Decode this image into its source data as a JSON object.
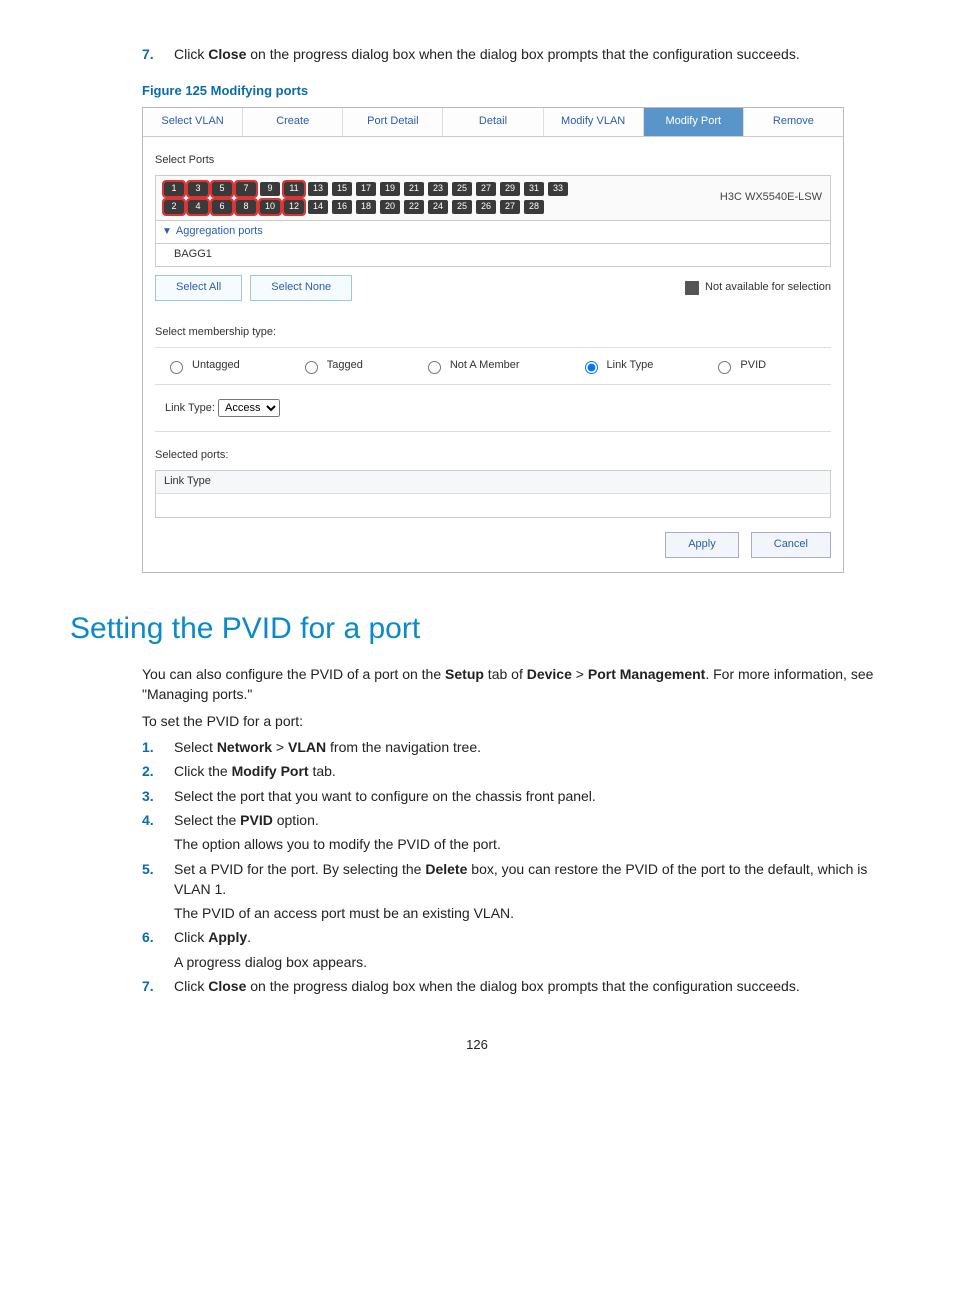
{
  "topStep": {
    "num": "7.",
    "text_a": "Click ",
    "bold": "Close",
    "text_b": " on the progress dialog box when the dialog box prompts that the configuration succeeds."
  },
  "figCaption": "Figure 125 Modifying ports",
  "tabs": [
    "Select VLAN",
    "Create",
    "Port Detail",
    "Detail",
    "Modify VLAN",
    "Modify Port",
    "Remove"
  ],
  "activeTab": 5,
  "selectPortsLabel": "Select Ports",
  "portsTop": [
    "1",
    "3",
    "5",
    "7",
    "9",
    "11",
    "13",
    "15",
    "17",
    "19",
    "21",
    "23",
    "25",
    "27",
    "29",
    "31",
    "33"
  ],
  "portsBottom": [
    "2",
    "4",
    "6",
    "8",
    "10",
    "12",
    "14",
    "16",
    "18",
    "20",
    "22",
    "24",
    "25",
    "26",
    "27",
    "28"
  ],
  "model": "H3C WX5540E-LSW",
  "aggHeader": "Aggregation ports",
  "aggItem": "BAGG1",
  "selectAll": "Select All",
  "selectNone": "Select None",
  "legend": "Not available for selection",
  "membershipLabel": "Select membership type:",
  "radios": [
    "Untagged",
    "Tagged",
    "Not A Member",
    "Link Type",
    "PVID"
  ],
  "radioSelected": 3,
  "linkTypeLabel": "Link Type:",
  "linkTypeValue": "Access",
  "selectedPortsLabel": "Selected ports:",
  "selectedPortsHead": "Link Type",
  "apply": "Apply",
  "cancel": "Cancel",
  "h1": "Setting the PVID for a port",
  "intro": {
    "a": "You can also configure the PVID of a port on the ",
    "b1": "Setup",
    "c": " tab of ",
    "b2": "Device",
    "d": " > ",
    "b3": "Port Management",
    "e": ". For more information, see \"Managing ports.\""
  },
  "lead2": "To set the PVID for a port:",
  "steps": [
    {
      "n": "1.",
      "parts": [
        "Select ",
        "Network",
        " > ",
        "VLAN",
        " from the navigation tree."
      ],
      "bolds": [
        1,
        3
      ]
    },
    {
      "n": "2.",
      "parts": [
        "Click the ",
        "Modify Port",
        " tab."
      ],
      "bolds": [
        1
      ]
    },
    {
      "n": "3.",
      "parts": [
        "Select the port that you want to configure on the chassis front panel."
      ],
      "bolds": []
    },
    {
      "n": "4.",
      "parts": [
        "Select the ",
        "PVID",
        " option."
      ],
      "bolds": [
        1
      ]
    }
  ],
  "subAfter4": "The option allows you to modify the PVID of the port.",
  "step5": {
    "n": "5.",
    "a": "Set a PVID for the port. By selecting the ",
    "b": "Delete",
    "c": " box, you can restore the PVID of the port to the default, which is VLAN 1."
  },
  "subAfter5": "The PVID of an access port must be an existing VLAN.",
  "step6": {
    "n": "6.",
    "a": "Click ",
    "b": "Apply",
    "c": "."
  },
  "subAfter6": "A progress dialog box appears.",
  "step7": {
    "n": "7.",
    "a": "Click ",
    "b": "Close",
    "c": " on the progress dialog box when the dialog box prompts that the configuration succeeds."
  },
  "pageNum": "126"
}
